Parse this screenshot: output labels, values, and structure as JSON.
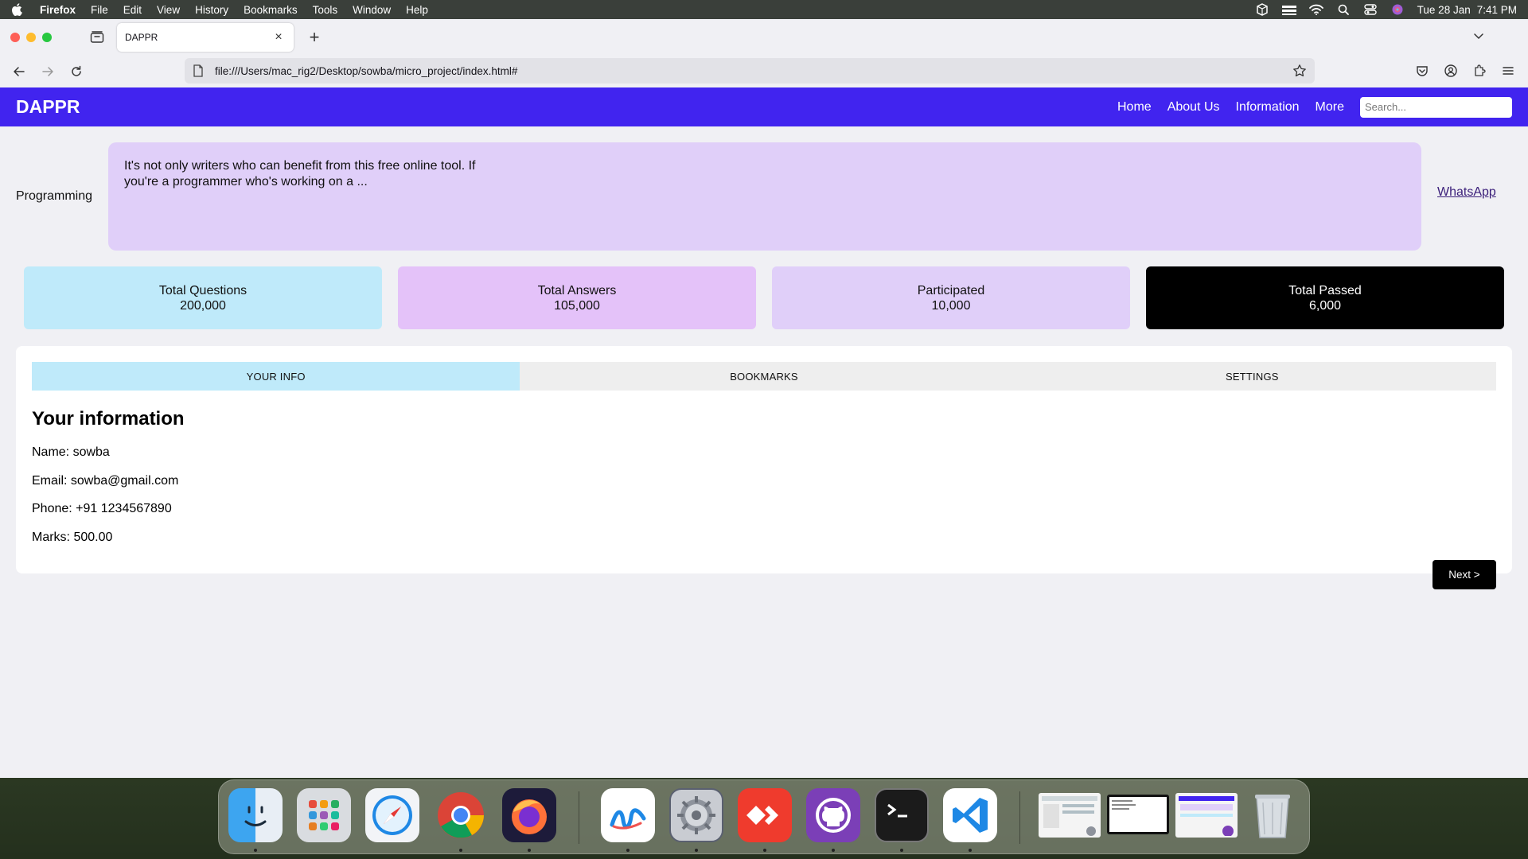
{
  "menubar": {
    "app": "Firefox",
    "items": [
      "File",
      "Edit",
      "View",
      "History",
      "Bookmarks",
      "Tools",
      "Window",
      "Help"
    ],
    "date": "Tue 28 Jan",
    "time": "7:41 PM",
    "status_icons": [
      "box-icon",
      "bookshelf-icon",
      "wifi-icon",
      "search-icon",
      "control-center-icon",
      "siri-icon"
    ]
  },
  "browser": {
    "tab_title": "DAPPR",
    "url": "file:///Users/mac_rig2/Desktop/sowba/micro_project/index.html#"
  },
  "site": {
    "brand": "DAPPR",
    "nav": [
      "Home",
      "About Us",
      "Information",
      "More"
    ],
    "search_placeholder": "Search...",
    "topic": {
      "label": "Programming",
      "text": "It's not only writers who can benefit from this free online tool. If you're a programmer who's working on a ...",
      "link": "WhatsApp"
    },
    "stats": [
      {
        "label": "Total Questions",
        "value": "200,000"
      },
      {
        "label": "Total Answers",
        "value": "105,000"
      },
      {
        "label": "Participated",
        "value": "10,000"
      },
      {
        "label": "Total Passed",
        "value": "6,000"
      }
    ],
    "tabs": [
      "YOUR INFO",
      "BOOKMARKS",
      "SETTINGS"
    ],
    "info": {
      "heading": "Your information",
      "name": "Name: sowba",
      "email": "Email: sowba@gmail.com",
      "phone": "Phone: +91 1234567890",
      "marks": "Marks: 500.00"
    },
    "next_button": "Next >"
  },
  "dock": {
    "apps": [
      "finder-icon",
      "launchpad-icon",
      "safari-icon",
      "chrome-icon",
      "firefox-icon",
      "freeform-icon",
      "system-settings-icon",
      "anydesk-icon",
      "github-desktop-icon",
      "terminal-icon",
      "vscode-icon",
      "window-thumbnail-1",
      "window-thumbnail-2",
      "window-thumbnail-3",
      "trash-icon"
    ]
  },
  "colors": {
    "brand_header": "#4124ef",
    "topic_card": "#e0cff9",
    "stat_1": "#bfeafa",
    "stat_2": "#e4c2f9",
    "stat_3": "#e0cff9",
    "stat_4": "#000000",
    "active_tab": "#bfeafa"
  }
}
